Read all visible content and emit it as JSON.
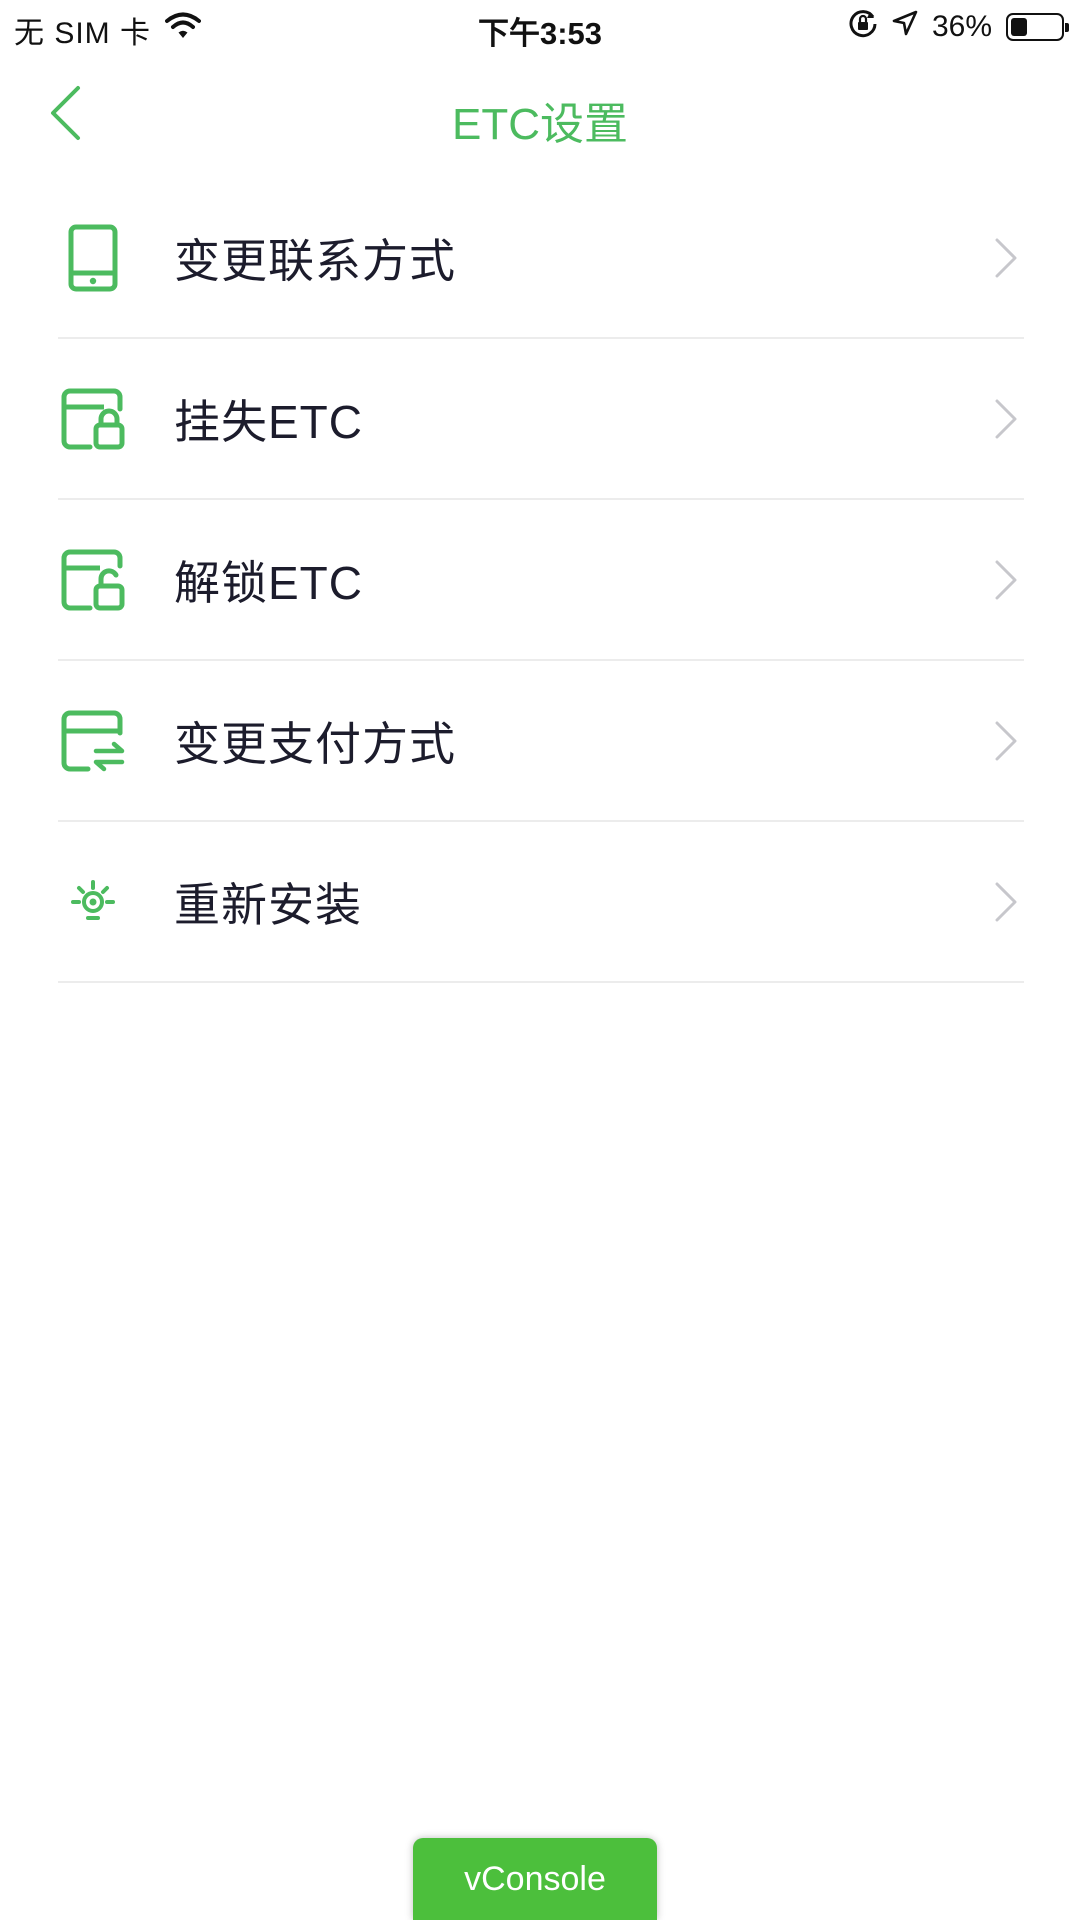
{
  "status_bar": {
    "carrier": "无 SIM 卡",
    "time": "下午3:53",
    "battery_text": "36%",
    "battery_level": 0.36,
    "wifi_icon": "wifi-icon",
    "rotation_lock_icon": "rotation-lock-icon",
    "location_icon": "location-arrow-icon"
  },
  "nav": {
    "title": "ETC设置",
    "back_icon": "chevron-left-icon"
  },
  "menu": {
    "items": [
      {
        "label": "变更联系方式",
        "icon": "phone-icon"
      },
      {
        "label": "挂失ETC",
        "icon": "card-lock-icon"
      },
      {
        "label": "解锁ETC",
        "icon": "card-unlock-icon"
      },
      {
        "label": "变更支付方式",
        "icon": "card-exchange-icon"
      },
      {
        "label": "重新安装",
        "icon": "bulb-icon"
      }
    ]
  },
  "vconsole": {
    "label": "vConsole"
  },
  "colors": {
    "accent": "#4cbb5f",
    "vconsole": "#4cbf3c",
    "chevron": "#c7c7cc",
    "divider": "#ececec"
  }
}
